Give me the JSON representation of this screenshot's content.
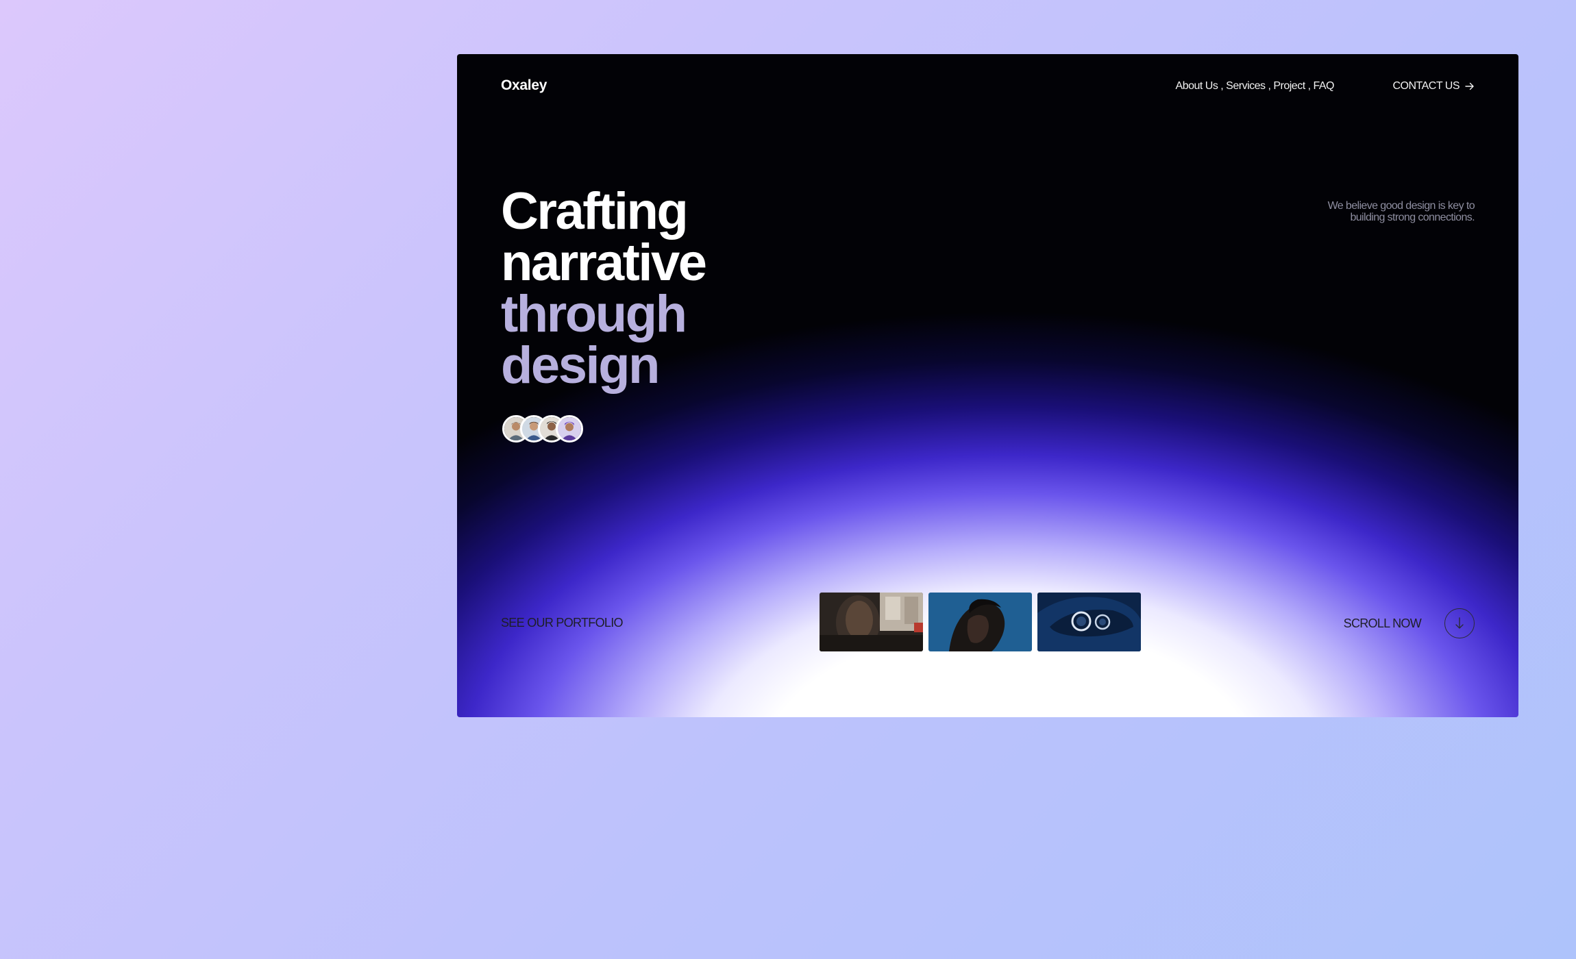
{
  "nav": {
    "logo": "Oxaley",
    "links": "About Us , Services , Project , FAQ",
    "contact_label": "CONTACT US",
    "contact_icon": "arrow-right-icon"
  },
  "hero": {
    "line1": "Crafting",
    "line2": "narrative",
    "line3": "through",
    "line4": "design"
  },
  "tagline": "We believe good design is key to building strong connections.",
  "avatars": [
    {
      "icon": "person-avatar-1"
    },
    {
      "icon": "person-avatar-2"
    },
    {
      "icon": "person-avatar-3"
    },
    {
      "icon": "person-avatar-4"
    }
  ],
  "portfolio": {
    "label": "SEE OUR PORTFOLIO",
    "thumbnails": [
      "car-interior-thumbnail",
      "portrait-thumbnail",
      "car-headlight-thumbnail"
    ]
  },
  "scroll": {
    "label": "SCROLL NOW",
    "icon": "arrow-down-icon"
  },
  "colors": {
    "background_start": "#dcc8fc",
    "background_end": "#aec3fb",
    "frame_dark": "#020206",
    "glow_purple": "#3d27c9",
    "hero_secondary": "#b7b0de"
  }
}
